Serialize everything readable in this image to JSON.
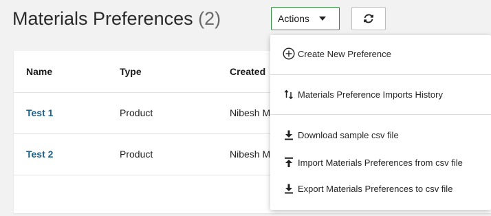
{
  "header": {
    "title": "Materials Preferences",
    "count": "(2)",
    "actions_label": "Actions",
    "refresh_icon": "refresh-icon"
  },
  "table": {
    "columns": [
      "Name",
      "Type",
      "Created"
    ],
    "rows": [
      {
        "name": "Test 1",
        "type": "Product",
        "created": "Nibesh M"
      },
      {
        "name": "Test 2",
        "type": "Product",
        "created": "Nibesh M"
      }
    ]
  },
  "menu": {
    "items": [
      {
        "label": "Create New Preference",
        "icon": "plus-circle-icon"
      },
      {
        "label": "Materials Preference Imports History",
        "icon": "sort-arrows-icon"
      },
      {
        "label": "Download sample csv file",
        "icon": "download-icon"
      },
      {
        "label": "Import Materials Preferences from csv file",
        "icon": "upload-icon"
      },
      {
        "label": "Export Materials Preferences to csv file",
        "icon": "download-icon"
      }
    ]
  },
  "colors": {
    "link": "#1e5f86",
    "actions_border": "#2f8a3c"
  }
}
